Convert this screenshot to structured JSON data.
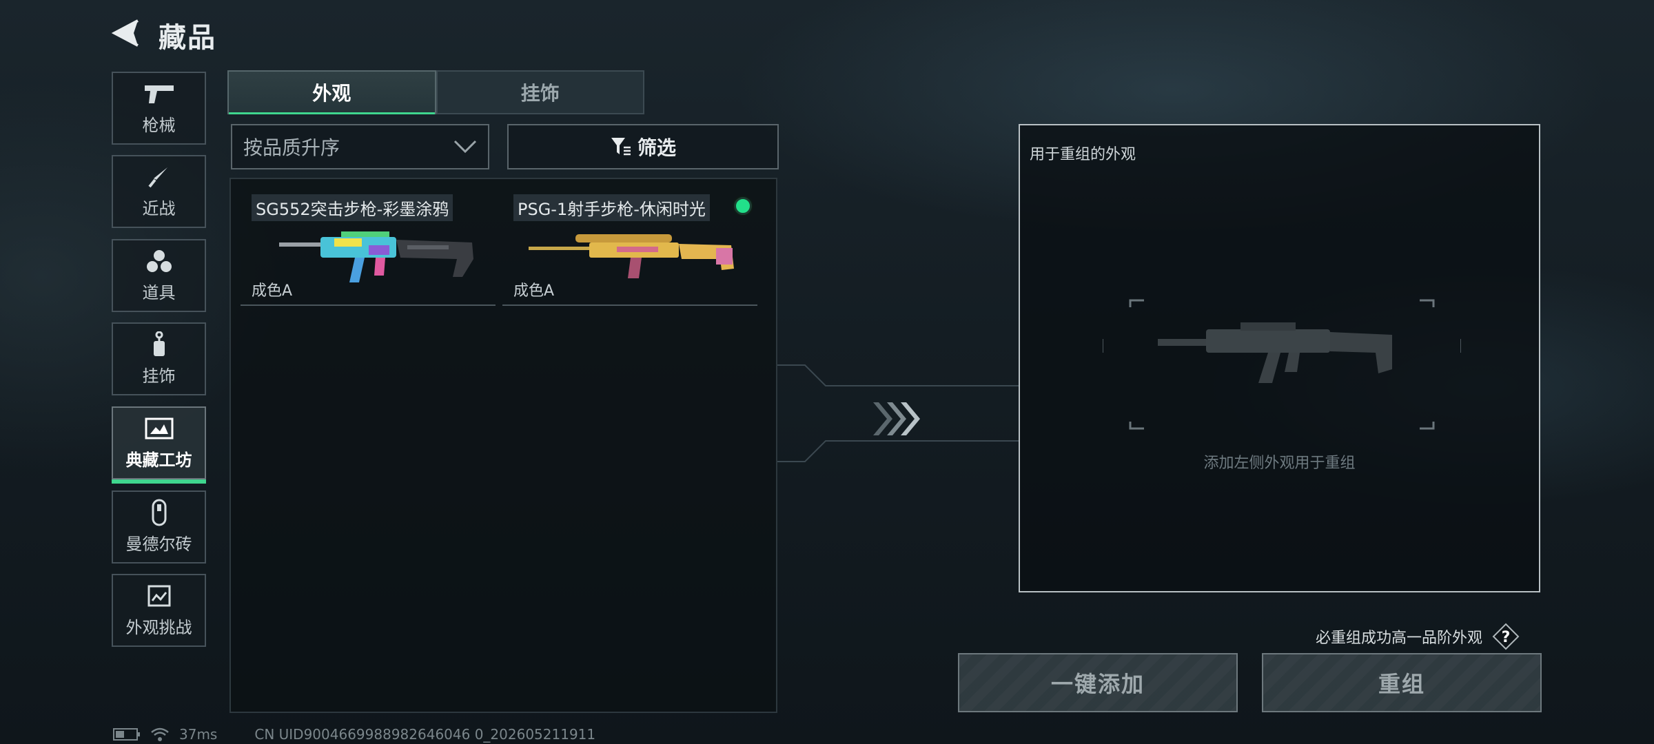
{
  "header": {
    "title": "藏品"
  },
  "sidebar": {
    "items": [
      {
        "label": "枪械",
        "icon": "pistol-icon"
      },
      {
        "label": "近战",
        "icon": "knife-icon"
      },
      {
        "label": "道具",
        "icon": "grenades-icon"
      },
      {
        "label": "挂饰",
        "icon": "charm-icon"
      },
      {
        "label": "典藏工坊",
        "icon": "workshop-icon",
        "active": true
      },
      {
        "label": "曼德尔砖",
        "icon": "mandel-brick-icon"
      },
      {
        "label": "外观挑战",
        "icon": "challenge-icon"
      }
    ]
  },
  "tabs": [
    {
      "label": "外观",
      "active": true
    },
    {
      "label": "挂饰",
      "active": false
    }
  ],
  "sort": {
    "label": "按品质升序"
  },
  "filter": {
    "label": "筛选"
  },
  "items": [
    {
      "name": "SG552突击步枪-彩墨涂鸦",
      "grade": "成色A",
      "selected": false
    },
    {
      "name": "PSG-1射手步枪-休闲时光",
      "grade": "成色A",
      "selected": true
    }
  ],
  "preview": {
    "caption": "用于重组的外观",
    "hint": "添加左侧外观用于重组"
  },
  "guarantee": {
    "text": "必重组成功高一品阶外观",
    "help_symbol": "?"
  },
  "actions": {
    "add_all": "一键添加",
    "recombine": "重组"
  },
  "status": {
    "ping": "37ms",
    "uid": "CN UID9004669988982646046 0_202605211911"
  },
  "colors": {
    "accent": "#3fd68e",
    "selected_dot": "#22e08a"
  }
}
